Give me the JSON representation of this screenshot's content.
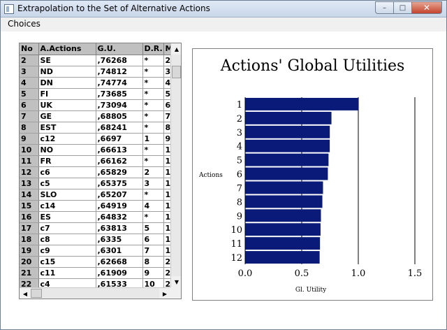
{
  "window": {
    "title": "Extrapolation to the Set of Alternative Actions",
    "buttons": {
      "minimize": "–",
      "maximize": "□",
      "close": "✕"
    }
  },
  "menu": {
    "choices": "Choices"
  },
  "grid": {
    "headers": [
      "No",
      "A.Actions",
      "G.U.",
      "D.R.",
      "M"
    ],
    "rows": [
      {
        "no": "2",
        "action": "SE",
        "gu": ",76268",
        "dr": "*",
        "m": "2"
      },
      {
        "no": "3",
        "action": "ND",
        "gu": ",74812",
        "dr": "*",
        "m": "3"
      },
      {
        "no": "4",
        "action": "DN",
        "gu": ",74774",
        "dr": "*",
        "m": "4"
      },
      {
        "no": "5",
        "action": "FI",
        "gu": ",73685",
        "dr": "*",
        "m": "5"
      },
      {
        "no": "6",
        "action": "UK",
        "gu": ",73094",
        "dr": "*",
        "m": "6"
      },
      {
        "no": "7",
        "action": "GE",
        "gu": ",68805",
        "dr": "*",
        "m": "7"
      },
      {
        "no": "8",
        "action": "EST",
        "gu": ",68241",
        "dr": "*",
        "m": "8"
      },
      {
        "no": "9",
        "action": "c12",
        "gu": ",6697",
        "dr": "1",
        "m": "9"
      },
      {
        "no": "10",
        "action": "NO",
        "gu": ",66613",
        "dr": "*",
        "m": "1"
      },
      {
        "no": "11",
        "action": "FR",
        "gu": ",66162",
        "dr": "*",
        "m": "1"
      },
      {
        "no": "12",
        "action": "c6",
        "gu": ",65829",
        "dr": "2",
        "m": "1"
      },
      {
        "no": "13",
        "action": "c5",
        "gu": ",65375",
        "dr": "3",
        "m": "1"
      },
      {
        "no": "14",
        "action": "SLO",
        "gu": ",65207",
        "dr": "*",
        "m": "1"
      },
      {
        "no": "15",
        "action": "c14",
        "gu": ",64919",
        "dr": "4",
        "m": "1"
      },
      {
        "no": "16",
        "action": "ES",
        "gu": ",64832",
        "dr": "*",
        "m": "1"
      },
      {
        "no": "17",
        "action": "c7",
        "gu": ",63813",
        "dr": "5",
        "m": "1"
      },
      {
        "no": "18",
        "action": "c8",
        "gu": ",6335",
        "dr": "6",
        "m": "1"
      },
      {
        "no": "19",
        "action": "c9",
        "gu": ",6301",
        "dr": "7",
        "m": "1"
      },
      {
        "no": "20",
        "action": "c15",
        "gu": ",62668",
        "dr": "8",
        "m": "2"
      },
      {
        "no": "21",
        "action": "c11",
        "gu": ",61909",
        "dr": "9",
        "m": "2"
      },
      {
        "no": "22",
        "action": "c4",
        "gu": ",61533",
        "dr": "10",
        "m": "2"
      }
    ]
  },
  "colors": {
    "bar": "#0a1a78",
    "header_bg": "#c0c0c0"
  },
  "chart_data": {
    "type": "bar",
    "orientation": "horizontal",
    "title": "Actions' Global Utilities",
    "xlabel": "Gl. Utility",
    "ylabel": "Actions",
    "categories": [
      "1",
      "2",
      "3",
      "4",
      "5",
      "6",
      "7",
      "8",
      "9",
      "10",
      "11",
      "12"
    ],
    "values": [
      1.0,
      0.76268,
      0.74812,
      0.74774,
      0.73685,
      0.73094,
      0.68805,
      0.68241,
      0.6697,
      0.66613,
      0.66162,
      0.65829
    ],
    "xlim": [
      0,
      1.5
    ],
    "xticks": [
      "0.0",
      "0.5",
      "1.0",
      "1.5"
    ],
    "grid": "vertical lines at 0.5 and 1.0"
  }
}
